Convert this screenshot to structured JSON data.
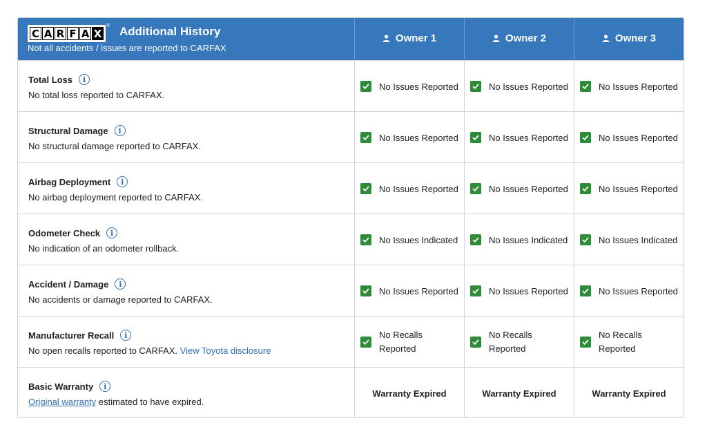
{
  "header": {
    "logo_letters": [
      "C",
      "A",
      "R",
      "F",
      "A",
      "X"
    ],
    "logo_reg": "®",
    "title": "Additional History",
    "subtitle": "Not all accidents / issues are reported to CARFAX",
    "owners": [
      "Owner 1",
      "Owner 2",
      "Owner 3"
    ],
    "color": "#3777bc"
  },
  "rows": [
    {
      "title": "Total Loss",
      "desc": "No total loss reported to CARFAX.",
      "status": [
        "No Issues Reported",
        "No Issues Reported",
        "No Issues Reported"
      ]
    },
    {
      "title": "Structural Damage",
      "desc": "No structural damage reported to CARFAX.",
      "status": [
        "No Issues Reported",
        "No Issues Reported",
        "No Issues Reported"
      ]
    },
    {
      "title": "Airbag Deployment",
      "desc": "No airbag deployment reported to CARFAX.",
      "status": [
        "No Issues Reported",
        "No Issues Reported",
        "No Issues Reported"
      ]
    },
    {
      "title": "Odometer Check",
      "desc": "No indication of an odometer rollback.",
      "status": [
        "No Issues Indicated",
        "No Issues Indicated",
        "No Issues Indicated"
      ]
    },
    {
      "title": "Accident / Damage",
      "desc": "No accidents or damage reported to CARFAX.",
      "status": [
        "No Issues Reported",
        "No Issues Reported",
        "No Issues Reported"
      ]
    },
    {
      "title": "Manufacturer Recall",
      "desc": "No open recalls reported to CARFAX.",
      "link": "View Toyota disclosure",
      "status": [
        "No Recalls Reported",
        "No Recalls Reported",
        "No Recalls Reported"
      ]
    },
    {
      "title": "Basic Warranty",
      "link": "Original warranty",
      "desc": "estimated to have expired.",
      "status": [
        "Warranty Expired",
        "Warranty Expired",
        "Warranty Expired"
      ]
    }
  ],
  "icons": {
    "info": "info-circle-icon",
    "owner": "person-icon",
    "check": "checkbox-checked-icon"
  },
  "status_color": "#2e8b38",
  "link_color": "#2f6fb5"
}
